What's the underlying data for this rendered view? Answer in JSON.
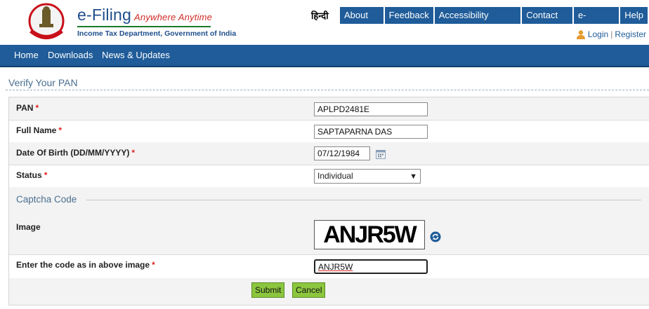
{
  "header": {
    "brand_title": "e-Filing",
    "brand_tagline": "Anywhere Anytime",
    "brand_subtitle": "Income Tax Department, Government of India",
    "emblem_icon": "national-emblem-icon",
    "hindi_link": "हिन्दी",
    "nav": [
      "About Us",
      "Feedback",
      "Accessibility Options",
      "Contact Us",
      "e-Nivaran",
      "Help"
    ],
    "login": "Login",
    "register": "Register",
    "separator": "|"
  },
  "mainnav": [
    "Home",
    "Downloads",
    "News & Updates"
  ],
  "section_title": "Verify Your PAN",
  "form": {
    "pan_label": "PAN",
    "pan_value": "APLPD2481E",
    "fullname_label": "Full Name",
    "fullname_value": "SAPTAPARNA DAS",
    "dob_label": "Date Of Birth (DD/MM/YYYY)",
    "dob_value": "07/12/1984",
    "status_label": "Status",
    "status_value": "Individual",
    "required_mark": "*"
  },
  "captcha": {
    "heading": "Captcha Code",
    "image_label": "Image",
    "image_text": "ANJR5W",
    "code_label": "Enter the code as in above image",
    "code_value": "ANJR5W"
  },
  "buttons": {
    "submit": "Submit",
    "cancel": "Cancel"
  },
  "colors": {
    "nav_blue": "#1f5c99",
    "button_green": "#8cc63f",
    "brand_red": "#d02b25"
  }
}
